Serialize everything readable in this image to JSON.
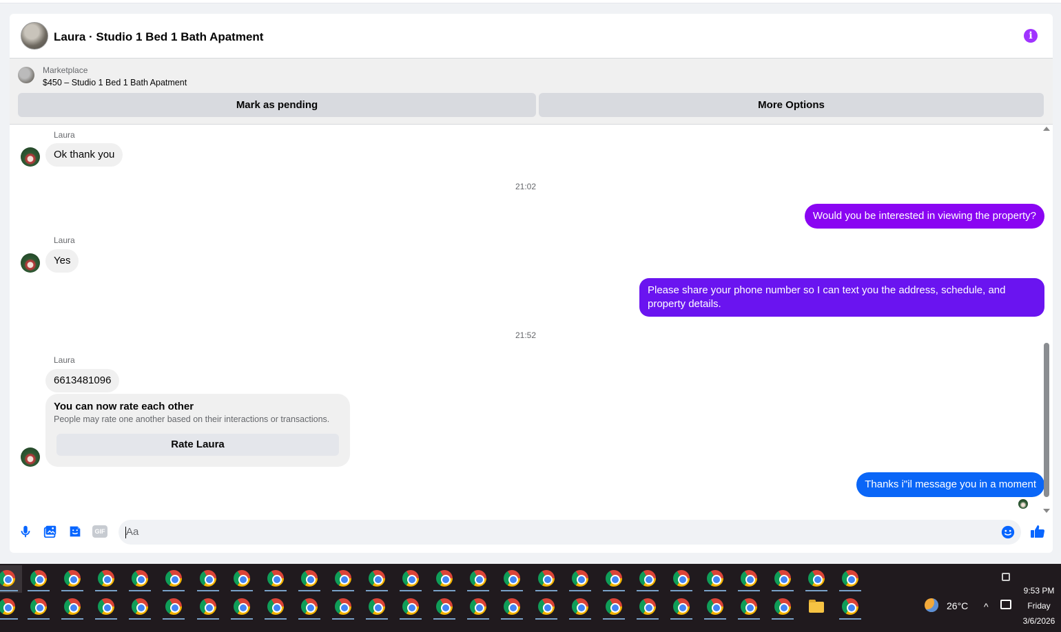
{
  "header": {
    "title": "Laura · Studio 1 Bed 1 Bath Apatment",
    "accent_color": "#a033ff"
  },
  "listing": {
    "source": "Marketplace",
    "price_line": "$450 – Studio 1 Bed 1 Bath Apatment",
    "mark_pending_label": "Mark as pending",
    "more_options_label": "More Options"
  },
  "messages": {
    "sender_name": "Laura",
    "m1": "Ok thank you",
    "time1": "21:02",
    "out1": "Would you be interested in viewing the property?",
    "m2": "Yes",
    "out2": "Please share your phone number so I can text you the address, schedule, and property details.",
    "time2": "21:52",
    "m3": "6613481096",
    "rate_title": "You can now rate each other",
    "rate_sub": "People may rate one another based on their interactions or transactions.",
    "rate_button": "Rate Laura",
    "out3": "Thanks i\"il message you in a moment",
    "out_color_purple": "#8a05f2",
    "out_color_blue": "#0a66f7"
  },
  "composer": {
    "placeholder": "Aa",
    "icons": [
      "microphone-icon",
      "photo-icon",
      "sticker-icon",
      "gif-icon",
      "emoji-icon",
      "thumbs-up-icon"
    ],
    "gif_label": "GIF"
  },
  "taskbar": {
    "weather_temp": "26°C",
    "time": "9:53 PM",
    "day": "Friday",
    "date": "3/6/2026"
  }
}
